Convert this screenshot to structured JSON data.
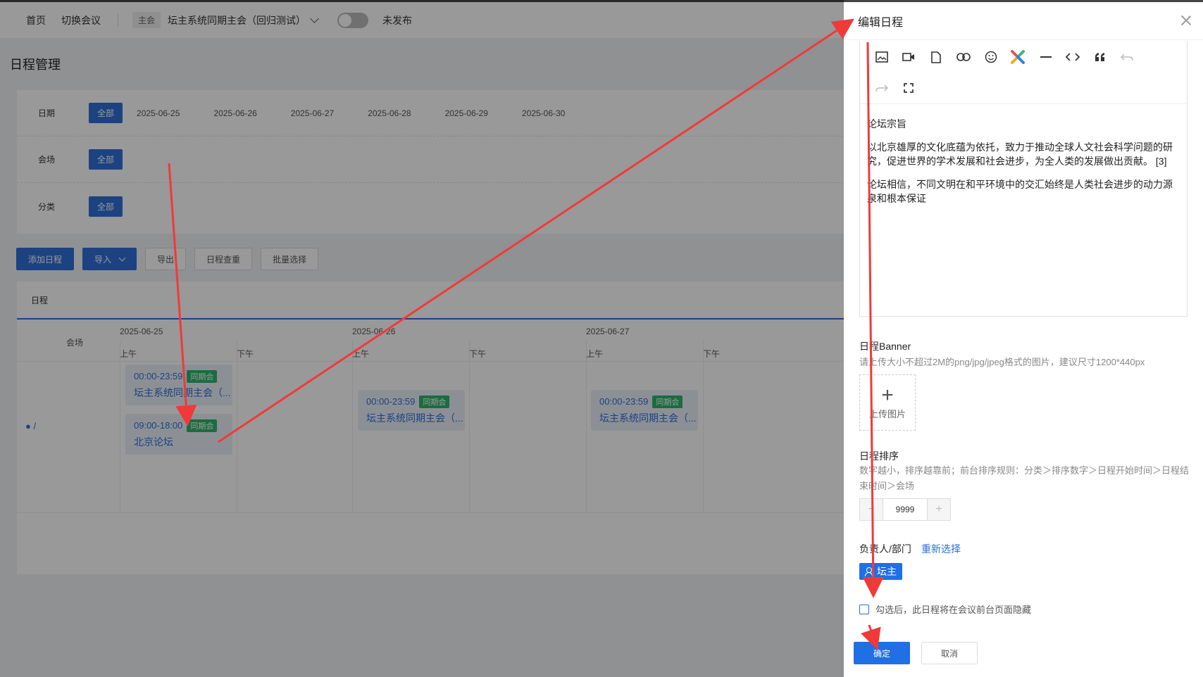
{
  "topbar": {
    "home": "首页",
    "switch_meeting": "切换会议",
    "meeting_tag": "主会",
    "meeting_name": "坛主系统同期主会（回归测试）",
    "publish_status": "未发布"
  },
  "page_title": "日程管理",
  "filters": {
    "date_label": "日期",
    "venue_label": "会场",
    "category_label": "分类",
    "all_label": "全部",
    "dates": [
      "2025-06-25",
      "2025-06-26",
      "2025-06-27",
      "2025-06-28",
      "2025-06-29",
      "2025-06-30"
    ]
  },
  "toolbar": {
    "add": "添加日程",
    "import": "导入",
    "export": "导出",
    "dedupe": "日程查重",
    "batch": "批量选择"
  },
  "grid": {
    "tab": "日程",
    "venue_header": "会场",
    "am": "上午",
    "pm": "下午",
    "venue_name": "/",
    "days": [
      "2025-06-25",
      "2025-06-26",
      "2025-06-27"
    ],
    "events": [
      {
        "time": "00:00-23:59",
        "badge": "同期会",
        "name": "坛主系统同期主会（..."
      },
      {
        "time": "09:00-18:00",
        "badge": "同期会",
        "name": "北京论坛"
      },
      {
        "time": "00:00-23:59",
        "badge": "同期会",
        "name": "坛主系统同期主会（..."
      },
      {
        "time": "00:00-23:59",
        "badge": "同期会",
        "name": "坛主系统同期主会（..."
      }
    ]
  },
  "drawer": {
    "title": "编辑日程",
    "content": {
      "heading": "论坛宗旨",
      "para1": "以北京雄厚的文化底蕴为依托，致力于推动全球人文社会科学问题的研究，促进世界的学术发展和社会进步，为全人类的发展做出贡献。 [3]",
      "para2": "论坛相信，不同文明在和平环境中的交汇始终是人类社会进步的动力源泉和根本保证"
    },
    "banner_label": "日程Banner",
    "banner_hint": "请上传大小不超过2M的png/jpg/jpeg格式的图片，建议尺寸1200*440px",
    "upload_text": "上传图片",
    "sort_label": "日程排序",
    "sort_hint": "数字越小，排序越靠前；前台排序规则：分类＞排序数字＞日程开始时间＞日程结束时间＞会场",
    "sort_value": "9999",
    "owner_label": "负责人/部门",
    "reselect": "重新选择",
    "owner_name": "坛主",
    "hide_text": "勾选后，此日程将在会议前台页面隐藏",
    "ok": "确定",
    "cancel": "取消"
  },
  "colors": {
    "accent": "#2f6ed8",
    "badge_green": "#2db46b",
    "annotation_red": "#f03a3a"
  }
}
